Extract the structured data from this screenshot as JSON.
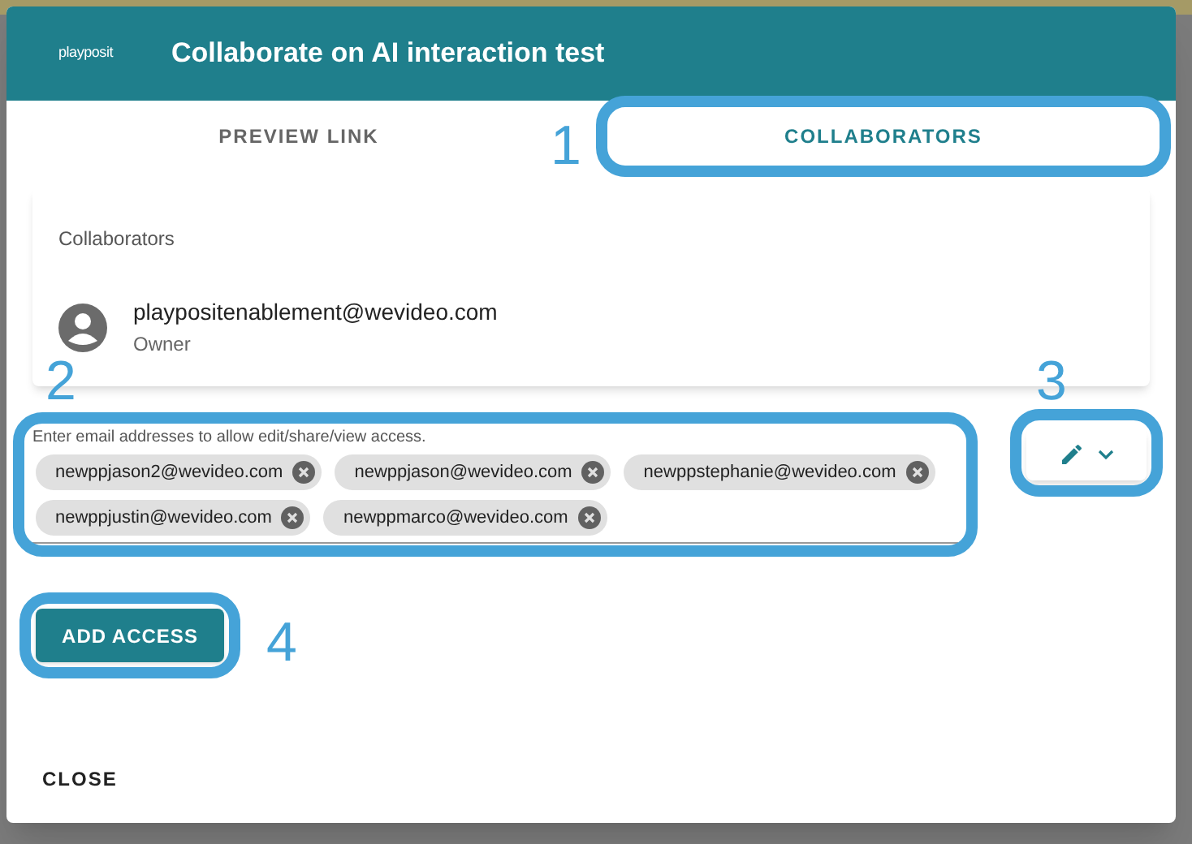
{
  "dialog": {
    "logo": "playposit",
    "title": "Collaborate on AI interaction test"
  },
  "tabs": [
    {
      "label": "PREVIEW LINK",
      "selected": false
    },
    {
      "label": "COLLABORATORS",
      "selected": true,
      "callout": "1"
    }
  ],
  "collaborators": {
    "heading": "Collaborators",
    "people": [
      {
        "email": "playpositenablement@wevideo.com",
        "role": "Owner"
      }
    ]
  },
  "email_field": {
    "label": "Enter email addresses to allow edit/share/view access.",
    "callout": "2",
    "chips": [
      {
        "text": "newppjason2@wevideo.com"
      },
      {
        "text": "newppjason@wevideo.com"
      },
      {
        "text": "newppstephanie@wevideo.com"
      },
      {
        "text": "newppjustin@wevideo.com"
      },
      {
        "text": "newppmarco@wevideo.com"
      }
    ]
  },
  "permission_button": {
    "callout": "3"
  },
  "add_button": {
    "label": "ADD ACCESS",
    "callout": "4"
  },
  "close_button": {
    "label": "CLOSE"
  }
}
